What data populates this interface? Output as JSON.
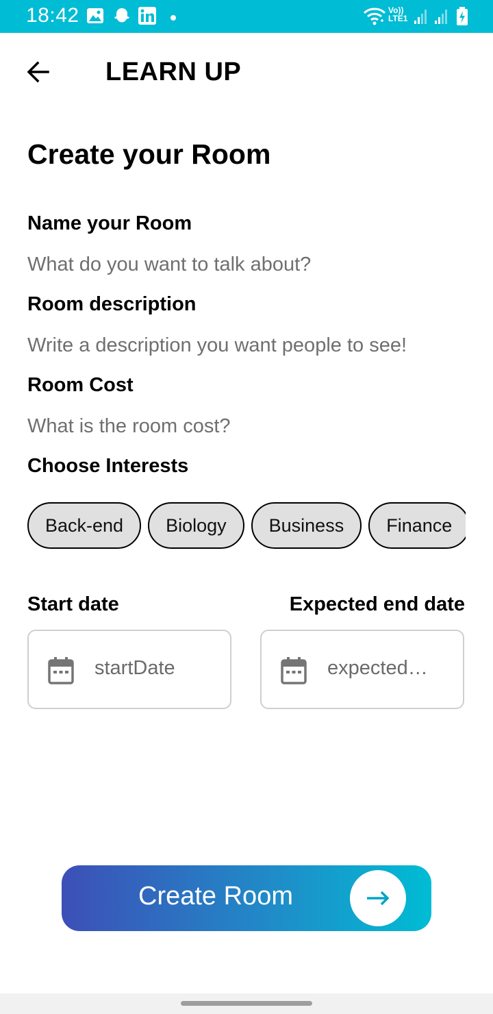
{
  "status_bar": {
    "time": "18:42",
    "left_icons": [
      "gallery-icon",
      "snapchat-icon",
      "linkedin-icon",
      "dot-icon"
    ],
    "right_icons": [
      "wifi-icon",
      "volte-icon",
      "signal-icon",
      "signal-icon",
      "battery-charging-icon"
    ],
    "volte_text": "Vo))",
    "lte_text": "LTE1",
    "color": "#00bcd4"
  },
  "app_bar": {
    "back_icon": "arrow-left-icon",
    "title": "LEARN UP"
  },
  "page": {
    "title": "Create your Room"
  },
  "form": {
    "name": {
      "label": "Name your Room",
      "placeholder": "What do you want to talk about?",
      "value": ""
    },
    "description": {
      "label": "Room description",
      "placeholder": "Write a description you want people to see!",
      "value": ""
    },
    "cost": {
      "label": "Room Cost",
      "placeholder": "What is the room cost?",
      "value": ""
    },
    "interests": {
      "label": "Choose Interests",
      "chips": [
        "Back-end",
        "Biology",
        "Business",
        "Finance"
      ]
    },
    "start_date": {
      "label": "Start date",
      "text": "startDate",
      "icon": "calendar-icon"
    },
    "end_date": {
      "label": "Expected end date",
      "text": "expected…",
      "icon": "calendar-icon"
    }
  },
  "create_button": {
    "label": "Create Room",
    "icon": "arrow-right-icon",
    "gradient_start": "#3d4fb7",
    "gradient_end": "#00bcd4"
  }
}
